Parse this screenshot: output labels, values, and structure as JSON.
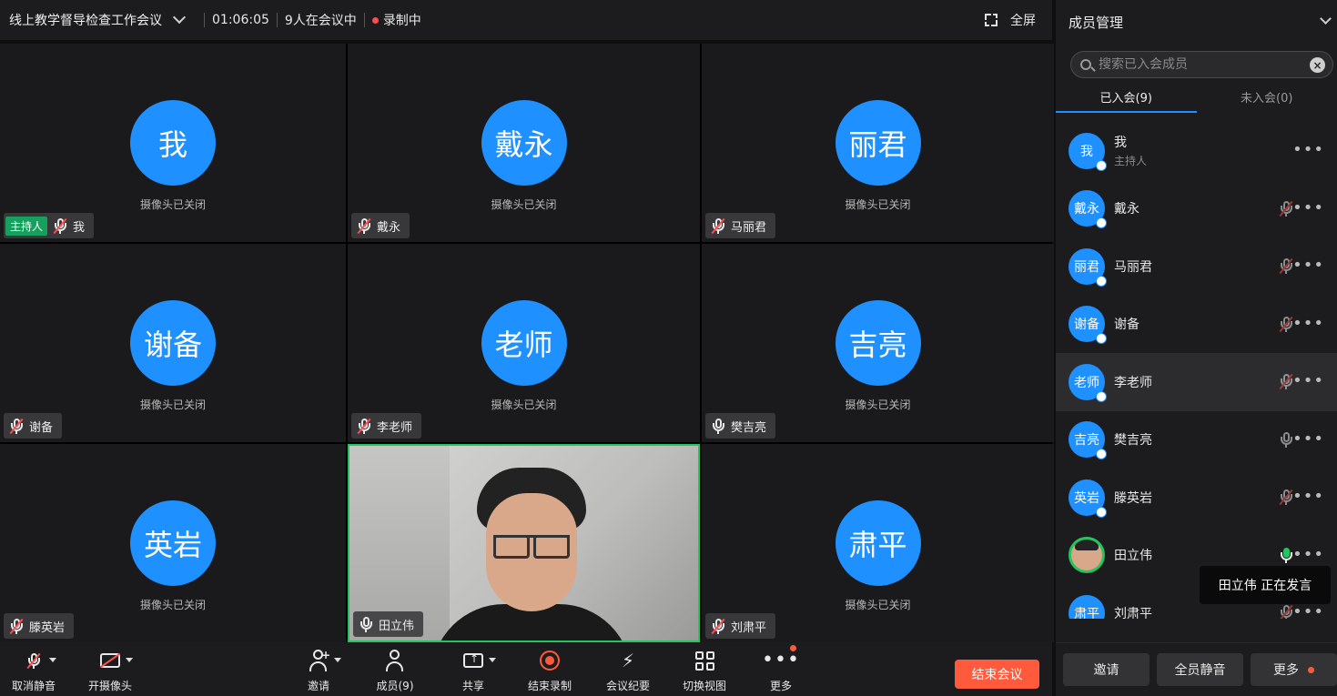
{
  "topbar": {
    "title": "线上教学督导检查工作会议",
    "duration": "01:06:05",
    "participants": "9人在会议中",
    "recording": "录制中",
    "fullscreen": "全屏"
  },
  "camera_off_text": "摄像头已关闭",
  "host_badge": "主持人",
  "tiles": [
    {
      "avatar": "我",
      "name": "我"
    },
    {
      "avatar": "戴永",
      "name": "戴永"
    },
    {
      "avatar": "丽君",
      "name": "马丽君"
    },
    {
      "avatar": "谢备",
      "name": "谢备"
    },
    {
      "avatar": "老师",
      "name": "李老师"
    },
    {
      "avatar": "吉亮",
      "name": "樊吉亮"
    },
    {
      "avatar": "英岩",
      "name": "滕英岩"
    },
    {
      "avatar": "",
      "name": "田立伟"
    },
    {
      "avatar": "肃平",
      "name": "刘肃平"
    }
  ],
  "toolbar": {
    "unmute": "取消静音",
    "camera": "开摄像头",
    "invite": "邀请",
    "members": "成员(9)",
    "share": "共享",
    "end_record": "结束录制",
    "minutes": "会议纪要",
    "switch_view": "切换视图",
    "more": "更多",
    "end_meeting": "结束会议"
  },
  "sidebar": {
    "title": "成员管理",
    "search_placeholder": "搜索已入会成员",
    "tab_joined": "已入会(9)",
    "tab_not_joined": "未入会(0)",
    "members": [
      {
        "avatar": "我",
        "name": "我",
        "role": "主持人"
      },
      {
        "avatar": "戴永",
        "name": "戴永"
      },
      {
        "avatar": "丽君",
        "name": "马丽君"
      },
      {
        "avatar": "谢备",
        "name": "谢备"
      },
      {
        "avatar": "老师",
        "name": "李老师"
      },
      {
        "avatar": "吉亮",
        "name": "樊吉亮"
      },
      {
        "avatar": "英岩",
        "name": "滕英岩"
      },
      {
        "avatar": "",
        "name": "田立伟"
      },
      {
        "avatar": "肃平",
        "name": "刘肃平"
      }
    ],
    "tooltip": "田立伟  正在发言",
    "invite": "邀请",
    "mute_all": "全员静音",
    "more": "更多"
  },
  "colors": {
    "accent": "#1e90ff",
    "speaking": "#22c55e",
    "danger": "#ff5a3c"
  }
}
